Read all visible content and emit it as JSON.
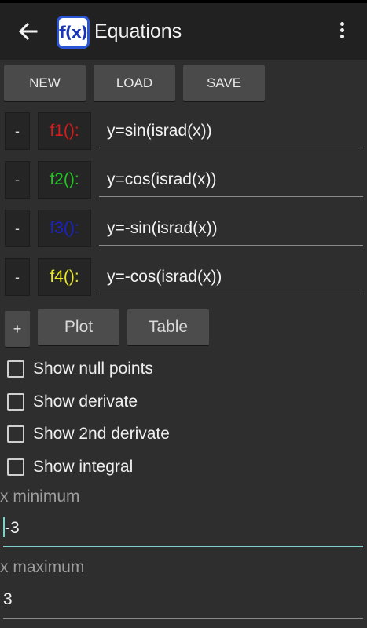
{
  "appbar": {
    "logo_text": "f(x)",
    "title": "Equations"
  },
  "toolbar": {
    "new_label": "NEW",
    "load_label": "LOAD",
    "save_label": "SAVE"
  },
  "functions": [
    {
      "remove_label": "-",
      "name": "f1():",
      "color": "#d81b1b",
      "expression": "y=sin(israd(x))"
    },
    {
      "remove_label": "-",
      "name": "f2():",
      "color": "#22c51f",
      "expression": "y=cos(israd(x))"
    },
    {
      "remove_label": "-",
      "name": "f3():",
      "color": "#1b22c8",
      "expression": "y=-sin(israd(x))"
    },
    {
      "remove_label": "-",
      "name": "f4():",
      "color": "#e8e829",
      "expression": "y=-cos(israd(x))"
    }
  ],
  "actions": {
    "add_label": "+",
    "plot_label": "Plot",
    "table_label": "Table"
  },
  "options": [
    {
      "label": "Show null points",
      "checked": false
    },
    {
      "label": "Show derivate",
      "checked": false
    },
    {
      "label": "Show 2nd derivate",
      "checked": false
    },
    {
      "label": "Show integral",
      "checked": false
    }
  ],
  "range": {
    "x_min_label": "x minimum",
    "x_min_value": "-3",
    "x_max_label": "x maximum",
    "x_max_value": "3"
  },
  "colors": {
    "accent": "#7fd1c7",
    "appbar": "#212121",
    "background": "#2e2e2e"
  },
  "icons": {
    "back": "arrow-left-icon",
    "overflow": "more-vertical-icon"
  }
}
